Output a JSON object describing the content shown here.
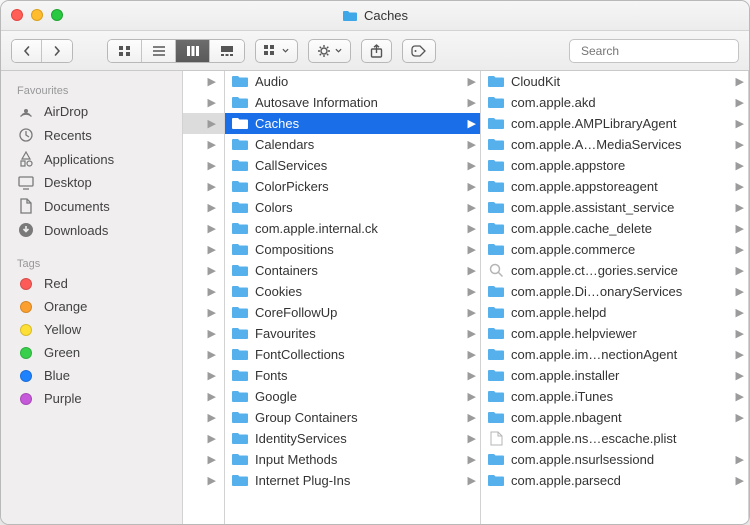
{
  "title": "Caches",
  "search": {
    "placeholder": "Search"
  },
  "sidebar": {
    "sections": [
      {
        "header": "Favourites",
        "items": [
          {
            "label": "AirDrop"
          },
          {
            "label": "Recents"
          },
          {
            "label": "Applications"
          },
          {
            "label": "Desktop"
          },
          {
            "label": "Documents"
          },
          {
            "label": "Downloads"
          }
        ]
      },
      {
        "header": "Tags",
        "items": [
          {
            "label": "Red",
            "color": "#fc5b57"
          },
          {
            "label": "Orange",
            "color": "#fba02f"
          },
          {
            "label": "Yellow",
            "color": "#fddf35"
          },
          {
            "label": "Green",
            "color": "#38cf4b"
          },
          {
            "label": "Blue",
            "color": "#1e82ff"
          },
          {
            "label": "Purple",
            "color": "#c559d9"
          }
        ]
      }
    ]
  },
  "col0_selected_index": 2,
  "col1": [
    {
      "label": "Audio",
      "type": "folder"
    },
    {
      "label": "Autosave Information",
      "type": "folder"
    },
    {
      "label": "Caches",
      "type": "folder",
      "selected": true
    },
    {
      "label": "Calendars",
      "type": "folder"
    },
    {
      "label": "CallServices",
      "type": "folder"
    },
    {
      "label": "ColorPickers",
      "type": "folder"
    },
    {
      "label": "Colors",
      "type": "folder"
    },
    {
      "label": "com.apple.internal.ck",
      "type": "folder"
    },
    {
      "label": "Compositions",
      "type": "folder"
    },
    {
      "label": "Containers",
      "type": "folder"
    },
    {
      "label": "Cookies",
      "type": "folder"
    },
    {
      "label": "CoreFollowUp",
      "type": "folder"
    },
    {
      "label": "Favourites",
      "type": "folder"
    },
    {
      "label": "FontCollections",
      "type": "folder"
    },
    {
      "label": "Fonts",
      "type": "folder"
    },
    {
      "label": "Google",
      "type": "folder"
    },
    {
      "label": "Group Containers",
      "type": "folder"
    },
    {
      "label": "IdentityServices",
      "type": "folder"
    },
    {
      "label": "Input Methods",
      "type": "folder"
    },
    {
      "label": "Internet Plug-Ins",
      "type": "folder"
    }
  ],
  "col2": [
    {
      "label": "CloudKit",
      "type": "folder"
    },
    {
      "label": "com.apple.akd",
      "type": "folder"
    },
    {
      "label": "com.apple.AMPLibraryAgent",
      "type": "folder"
    },
    {
      "label": "com.apple.A…MediaServices",
      "type": "folder"
    },
    {
      "label": "com.apple.appstore",
      "type": "folder"
    },
    {
      "label": "com.apple.appstoreagent",
      "type": "folder"
    },
    {
      "label": "com.apple.assistant_service",
      "type": "folder"
    },
    {
      "label": "com.apple.cache_delete",
      "type": "folder"
    },
    {
      "label": "com.apple.commerce",
      "type": "folder"
    },
    {
      "label": "com.apple.ct…gories.service",
      "type": "qlook"
    },
    {
      "label": "com.apple.Di…onaryServices",
      "type": "folder"
    },
    {
      "label": "com.apple.helpd",
      "type": "folder"
    },
    {
      "label": "com.apple.helpviewer",
      "type": "folder"
    },
    {
      "label": "com.apple.im…nectionAgent",
      "type": "folder"
    },
    {
      "label": "com.apple.installer",
      "type": "folder"
    },
    {
      "label": "com.apple.iTunes",
      "type": "folder"
    },
    {
      "label": "com.apple.nbagent",
      "type": "folder"
    },
    {
      "label": "com.apple.ns…escache.plist",
      "type": "file"
    },
    {
      "label": "com.apple.nsurlsessiond",
      "type": "folder"
    },
    {
      "label": "com.apple.parsecd",
      "type": "folder"
    }
  ]
}
